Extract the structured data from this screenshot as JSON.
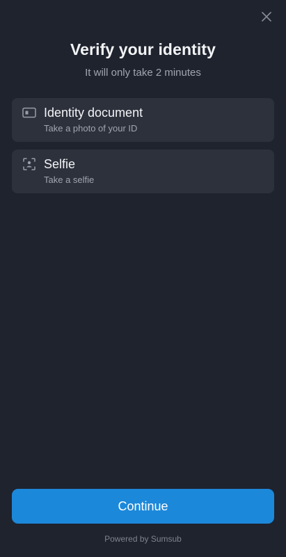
{
  "header": {
    "close_icon": "close-icon",
    "title": "Verify your identity",
    "subtitle": "It will only take 2 minutes"
  },
  "steps": [
    {
      "icon": "id-card-icon",
      "title": "Identity document",
      "description": "Take a photo of your ID"
    },
    {
      "icon": "face-scan-icon",
      "title": "Selfie",
      "description": "Take a selfie"
    }
  ],
  "footer": {
    "continue_label": "Continue",
    "powered_by": "Powered by Sumsub"
  },
  "colors": {
    "background": "#1f232e",
    "card": "#2d313c",
    "primary": "#1c88da",
    "text_primary": "#f3f4f6",
    "text_secondary": "#a1a5b0"
  }
}
